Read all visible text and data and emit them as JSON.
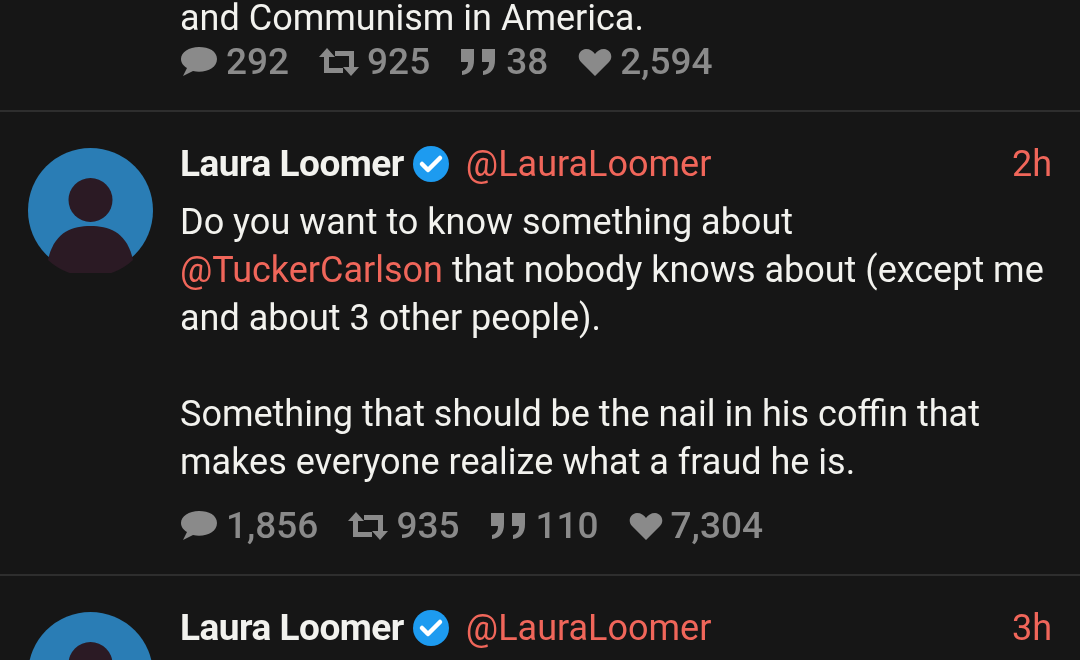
{
  "tweets": [
    {
      "body": [
        [
          {
            "kind": "text",
            "text": "and Communism in America."
          }
        ]
      ],
      "stats": {
        "replies": "292",
        "retweets": "925",
        "quotes": "38",
        "likes": "2,594"
      }
    },
    {
      "name": "Laura Loomer",
      "verified": true,
      "handle": "@LauraLoomer",
      "time": "2h",
      "body": [
        [
          {
            "kind": "text",
            "text": "Do you want to know something about "
          },
          {
            "kind": "mention",
            "text": "@TuckerCarlson"
          },
          {
            "kind": "text",
            "text": " that nobody knows about (except me and about 3 other people)."
          }
        ],
        [
          {
            "kind": "text",
            "text": "Something that should be the nail in his coffin that makes everyone realize what a fraud he is."
          }
        ]
      ],
      "stats": {
        "replies": "1,856",
        "retweets": "935",
        "quotes": "110",
        "likes": "7,304"
      }
    },
    {
      "name": "Laura Loomer",
      "verified": true,
      "handle": "@LauraLoomer",
      "time": "3h"
    }
  ]
}
